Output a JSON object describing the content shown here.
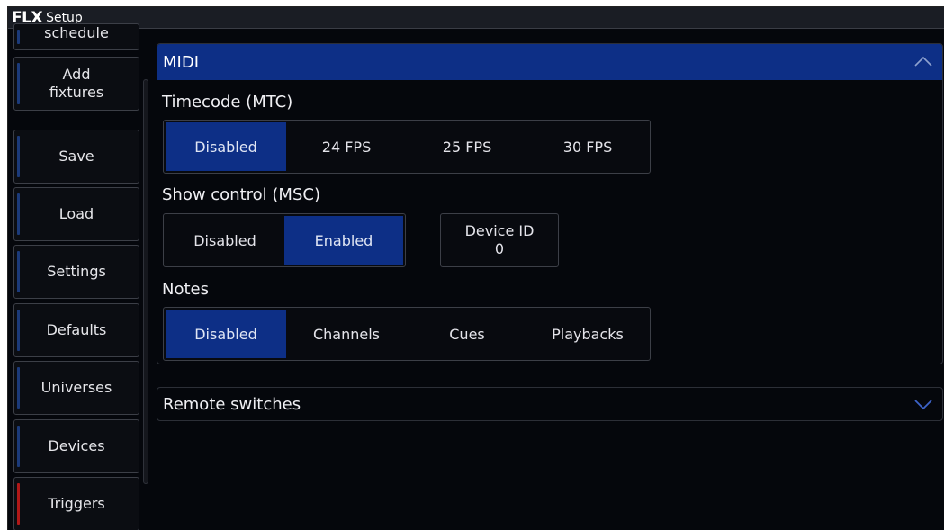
{
  "window": {
    "brand": "FLX",
    "title": "Setup"
  },
  "sidebar": {
    "items": [
      {
        "label": "schedule"
      },
      {
        "label": "Add\nfixtures"
      },
      {
        "label": "Save"
      },
      {
        "label": "Load"
      },
      {
        "label": "Settings"
      },
      {
        "label": "Defaults"
      },
      {
        "label": "Universes"
      },
      {
        "label": "Devices"
      },
      {
        "label": "Triggers",
        "active": true
      }
    ]
  },
  "midi": {
    "header": "MIDI",
    "timecode": {
      "label": "Timecode (MTC)",
      "options": [
        "Disabled",
        "24 FPS",
        "25 FPS",
        "30 FPS"
      ],
      "selected": "Disabled"
    },
    "show_control": {
      "label": "Show control (MSC)",
      "options": [
        "Disabled",
        "Enabled"
      ],
      "selected": "Enabled",
      "device_id_label": "Device ID",
      "device_id_value": "0"
    },
    "notes": {
      "label": "Notes",
      "options": [
        "Disabled",
        "Channels",
        "Cues",
        "Playbacks"
      ],
      "selected": "Disabled"
    }
  },
  "remote_switches": {
    "label": "Remote switches"
  },
  "colors": {
    "accent": "#0d2f86",
    "active_marker": "#b01818",
    "background": "#05070c"
  }
}
